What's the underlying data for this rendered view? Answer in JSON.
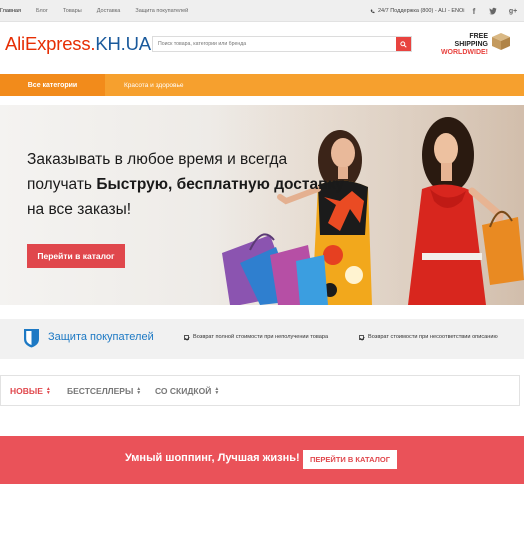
{
  "top_nav": {
    "items": [
      {
        "label": "Главная"
      },
      {
        "label": "Блог"
      },
      {
        "label": "Товары"
      },
      {
        "label": "Доставка"
      },
      {
        "label": "Защита покупателей"
      }
    ],
    "support": "24/7 Поддержка (800) - ALI - ENOi",
    "socials": [
      "facebook-icon",
      "twitter-icon",
      "google-plus-icon"
    ]
  },
  "header": {
    "logo_part1": "AliExpress.",
    "logo_part2": "KH.UA",
    "search_placeholder": "Поиск товара, категории или бренда",
    "free_shipping_line1": "FREE SHIPPING",
    "free_shipping_line2": "WORLDWIDE!"
  },
  "category_bar": {
    "all_label": "Все категории",
    "item_label": "Красота и здоровье"
  },
  "hero": {
    "line1": "Заказывать в любое время и всегда",
    "line2_pre": "получать ",
    "line2_bold": "Быструю, бесплатную доставку",
    "line3": "на все заказы!",
    "button": "Перейти в каталог"
  },
  "protection": {
    "title": "Защита покупателей",
    "item1": "Возврат полной стоимости при неполучении товара",
    "item2": "Возврат стоимости при несоответствии описанию"
  },
  "tabs": {
    "new": "НОВЫЕ",
    "best": "БЕСТСЕЛЛЕРЫ",
    "discount": "СО СКИДКОЙ"
  },
  "promo": {
    "text": "Умный шоппинг, Лучшая жизнь!",
    "button": "ПЕРЕЙТИ В КАТАЛОГ"
  },
  "colors": {
    "accent_red": "#e0474c",
    "orange": "#f6a02e",
    "blue": "#1d79c4"
  }
}
